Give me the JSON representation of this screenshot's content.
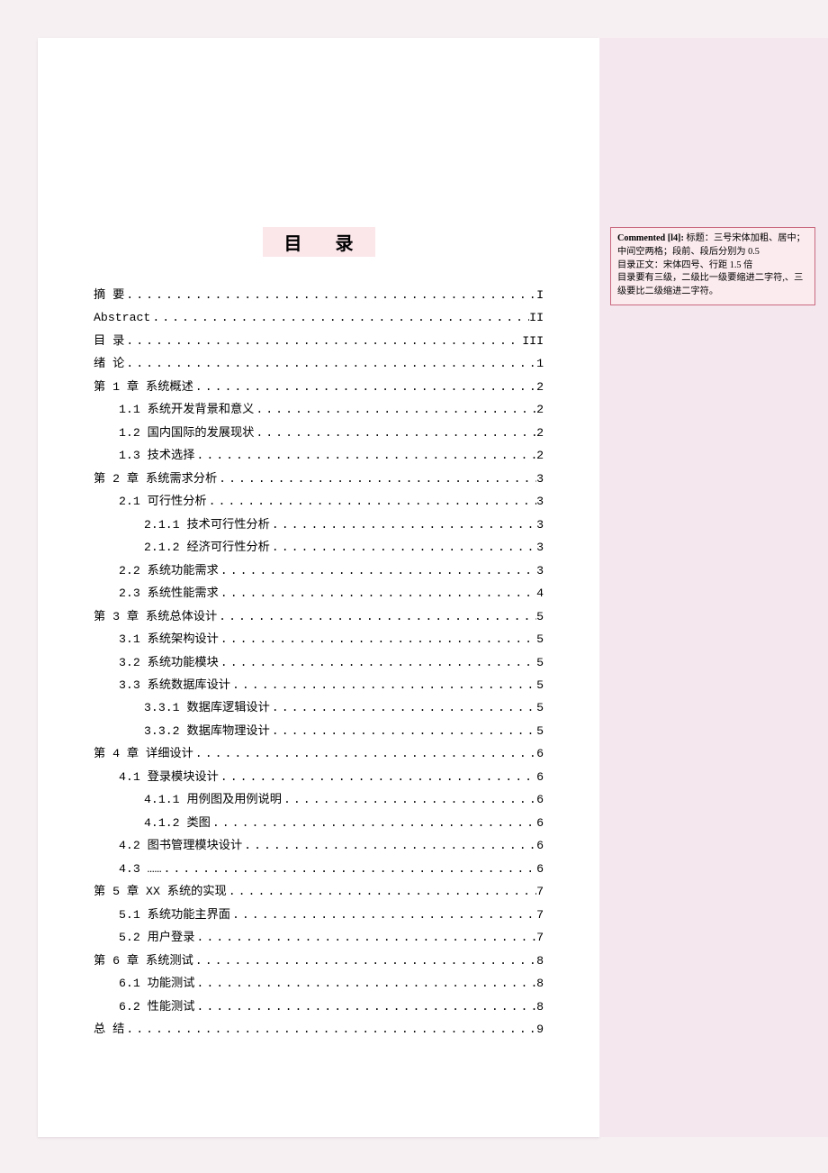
{
  "title": "目 录",
  "toc": [
    {
      "level": 1,
      "label": "摘  要",
      "page": "I"
    },
    {
      "level": 1,
      "label": "Abstract",
      "page": "II"
    },
    {
      "level": 1,
      "label": "目  录",
      "page": "III"
    },
    {
      "level": 1,
      "label": "绪  论",
      "page": "1"
    },
    {
      "level": 1,
      "label": "第 1 章 系统概述",
      "page": "2"
    },
    {
      "level": 2,
      "label": "1.1 系统开发背景和意义",
      "page": "2"
    },
    {
      "level": 2,
      "label": "1.2 国内国际的发展现状",
      "page": "2"
    },
    {
      "level": 2,
      "label": "1.3 技术选择",
      "page": "2"
    },
    {
      "level": 1,
      "label": "第 2 章 系统需求分析",
      "page": "3"
    },
    {
      "level": 2,
      "label": "2.1 可行性分析",
      "page": "3"
    },
    {
      "level": 3,
      "label": "2.1.1 技术可行性分析",
      "page": "3"
    },
    {
      "level": 3,
      "label": "2.1.2 经济可行性分析",
      "page": "3"
    },
    {
      "level": 2,
      "label": "2.2 系统功能需求",
      "page": "3"
    },
    {
      "level": 2,
      "label": "2.3 系统性能需求",
      "page": "4"
    },
    {
      "level": 1,
      "label": "第 3 章 系统总体设计",
      "page": "5"
    },
    {
      "level": 2,
      "label": "3.1 系统架构设计",
      "page": "5"
    },
    {
      "level": 2,
      "label": "3.2 系统功能模块",
      "page": "5"
    },
    {
      "level": 2,
      "label": "3.3 系统数据库设计",
      "page": "5"
    },
    {
      "level": 3,
      "label": "3.3.1 数据库逻辑设计",
      "page": "5"
    },
    {
      "level": 3,
      "label": "3.3.2 数据库物理设计",
      "page": "5"
    },
    {
      "level": 1,
      "label": "第 4 章 详细设计",
      "page": "6"
    },
    {
      "level": 2,
      "label": "4.1 登录模块设计",
      "page": "6"
    },
    {
      "level": 3,
      "label": "4.1.1 用例图及用例说明",
      "page": "6"
    },
    {
      "level": 3,
      "label": "4.1.2 类图",
      "page": "6"
    },
    {
      "level": 2,
      "label": "4.2 图书管理模块设计",
      "page": "6"
    },
    {
      "level": 2,
      "label": "4.3 ……",
      "page": "6"
    },
    {
      "level": 1,
      "label": "第 5 章 XX 系统的实现",
      "page": "7"
    },
    {
      "level": 2,
      "label": "5.1 系统功能主界面",
      "page": "7"
    },
    {
      "level": 2,
      "label": "5.2 用户登录",
      "page": "7"
    },
    {
      "level": 1,
      "label": "第 6 章 系统测试",
      "page": "8"
    },
    {
      "level": 2,
      "label": "6.1 功能测试",
      "page": "8"
    },
    {
      "level": 2,
      "label": "6.2 性能测试",
      "page": "8"
    },
    {
      "level": 1,
      "label": "总  结",
      "page": "9"
    }
  ],
  "comment": {
    "label": "Commented [l4]: ",
    "text": "标题：三号宋体加粗、居中；中间空两格；段前、段后分别为 0.5\n目录正文：宋体四号、行距 1.5 倍\n目录要有三级，二级比一级要缩进二字符,、三级要比二级缩进二字符。"
  }
}
